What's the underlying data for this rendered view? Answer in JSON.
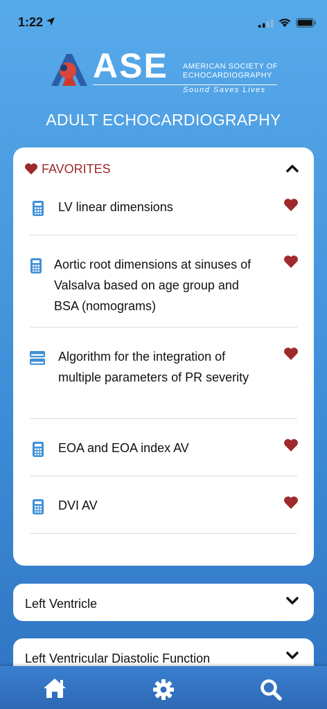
{
  "status_bar": {
    "time": "1:22"
  },
  "logo": {
    "acronym": "ASE",
    "org_line1": "AMERICAN SOCIETY OF",
    "org_line2": "ECHOCARDIOGRAPHY",
    "tagline": "Sound Saves Lives"
  },
  "page_title": "ADULT ECHOCARDIOGRAPHY",
  "favorites": {
    "title": "FAVORITES",
    "items": [
      {
        "label": "LV linear dimensions",
        "icon": "calculator-icon"
      },
      {
        "label": "Aortic root dimensions at sinuses of Valsalva based on age group and BSA (nomograms)",
        "icon": "calculator-icon"
      },
      {
        "label": "Algorithm for the integration of multiple parameters of PR severity",
        "icon": "algorithm-icon"
      },
      {
        "label": "EOA and EOA index AV",
        "icon": "calculator-icon"
      },
      {
        "label": "DVI AV",
        "icon": "calculator-icon"
      }
    ]
  },
  "sections": [
    {
      "label": "Left Ventricle"
    },
    {
      "label": "Left Ventricular Diastolic Function"
    }
  ],
  "tabs": [
    {
      "icon": "home-icon"
    },
    {
      "icon": "gear-icon"
    },
    {
      "icon": "search-icon"
    }
  ],
  "colors": {
    "accent_red": "#9e2a2b",
    "icon_blue": "#3f90d8",
    "background_top": "#57aaea",
    "background_bottom": "#2f73c2"
  }
}
